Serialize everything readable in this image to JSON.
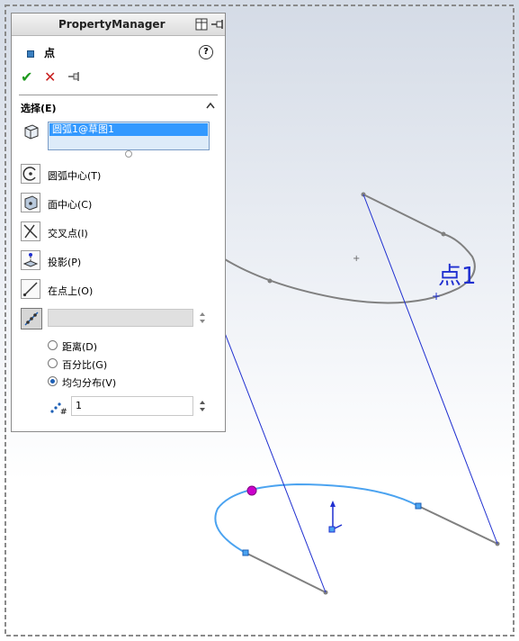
{
  "property_manager": {
    "title": "PropertyManager",
    "feature_name": "点",
    "help_glyph": "?",
    "ok_glyph": "✔",
    "cancel_glyph": "✕",
    "selection_section": {
      "label": "选择(E)",
      "selected_items": [
        "圆弧1@草图1"
      ]
    },
    "options": [
      {
        "label": "圆弧中心(T)",
        "icon": "arc-center-icon"
      },
      {
        "label": "面中心(C)",
        "icon": "face-center-icon"
      },
      {
        "label": "交叉点(I)",
        "icon": "intersection-icon"
      },
      {
        "label": "投影(P)",
        "icon": "projection-icon"
      },
      {
        "label": "在点上(O)",
        "icon": "on-point-icon"
      }
    ],
    "distribution": {
      "value_field": "",
      "radios": [
        {
          "label": "距离(D)",
          "selected": false
        },
        {
          "label": "百分比(G)",
          "selected": false
        },
        {
          "label": "均匀分布(V)",
          "selected": true
        }
      ],
      "count_value": "1"
    }
  },
  "viewport": {
    "point_label": "点1",
    "colors": {
      "sketch_gray": "#808080",
      "projection_blue": "#1f2fd0",
      "highlight_arc": "#4ba3f0",
      "point_magenta": "#cc00cc"
    }
  }
}
